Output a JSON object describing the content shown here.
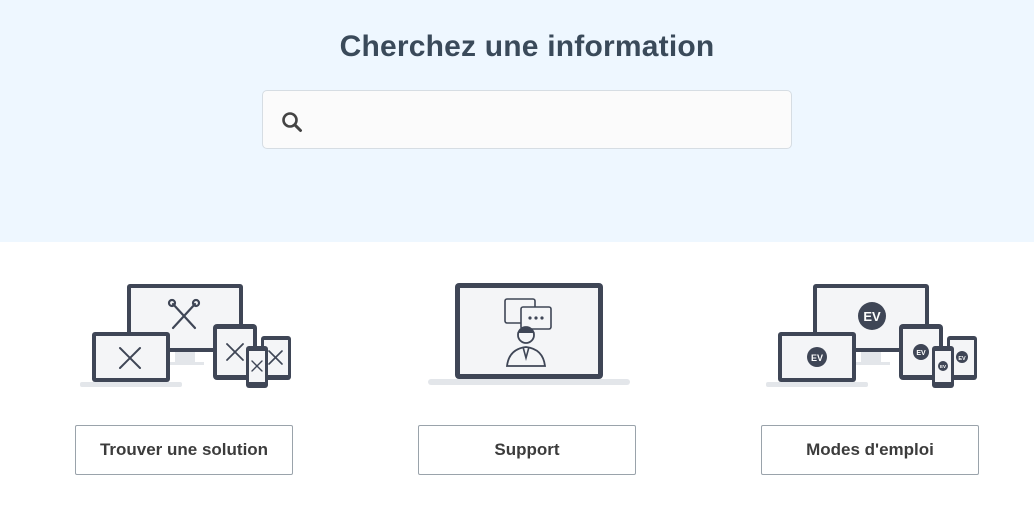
{
  "hero": {
    "title": "Cherchez une information",
    "search": {
      "value": "",
      "placeholder": "",
      "icon": "search-icon"
    }
  },
  "cards": [
    {
      "icon": "devices-tools-icon",
      "button_label": "Trouver une solution"
    },
    {
      "icon": "laptop-support-agent-icon",
      "button_label": "Support"
    },
    {
      "icon": "devices-expressvpn-icon",
      "button_label": "Modes d'emploi"
    }
  ],
  "colors": {
    "hero_background": "#eef7ff",
    "title": "#3a4a5a",
    "device_frame": "#3f4656",
    "button_border": "#9aa3ab"
  }
}
